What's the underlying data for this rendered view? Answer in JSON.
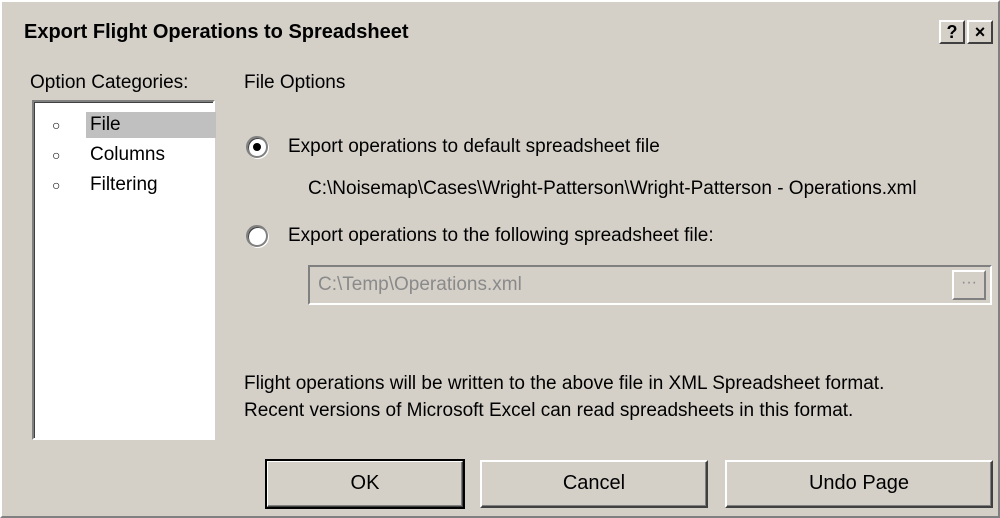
{
  "window": {
    "title": "Export Flight Operations to Spreadsheet",
    "help_label": "?",
    "close_label": "×"
  },
  "categories": {
    "label": "Option Categories:",
    "items": [
      {
        "label": "File",
        "selected": true
      },
      {
        "label": "Columns",
        "selected": false
      },
      {
        "label": "Filtering",
        "selected": false
      }
    ]
  },
  "file_options": {
    "title": "File Options",
    "option_default": {
      "label": "Export operations to default spreadsheet file",
      "selected": true,
      "path": "C:\\Noisemap\\Cases\\Wright-Patterson\\Wright-Patterson - Operations.xml"
    },
    "option_custom": {
      "label": "Export operations to the following spreadsheet file:",
      "selected": false,
      "path_value": "C:\\Temp\\Operations.xml",
      "browse_label": "···"
    },
    "info_line1": "Flight operations will be written to the above file in XML Spreadsheet format.",
    "info_line2": "Recent versions of Microsoft Excel can read spreadsheets in this format."
  },
  "buttons": {
    "ok": "OK",
    "cancel": "Cancel",
    "undo": "Undo Page"
  },
  "colors": {
    "dialog_bg": "#d4d0c8",
    "selection_bg": "#c0c0c0",
    "disabled_text": "#8a8a8a"
  }
}
